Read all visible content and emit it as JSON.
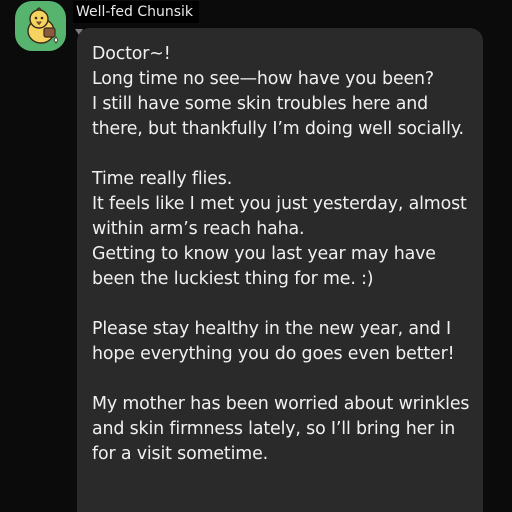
{
  "chat": {
    "sender_name": "Well-fed Chunsik",
    "avatar_icon": "chick-character-icon",
    "colors": {
      "background": "#0b0b0b",
      "bubble": "#2a2a2a",
      "avatar_bg": "#57b46f",
      "text": "#f0f0f0"
    },
    "message": {
      "lines": [
        "Doctor~!",
        "Long time no see—how have you been?",
        "I still have some skin troubles here and",
        "there, but thankfully I’m doing well socially.",
        "",
        "Time really flies.",
        "It feels like I met you just yesterday, almost",
        "within arm’s reach haha.",
        "Getting to know you last year may have",
        "been the luckiest thing for me. :)",
        "",
        "Please stay healthy in the new year, and I",
        "hope everything you do goes even better!",
        "",
        "My mother has been worried about wrinkles",
        "and skin firmness lately, so I’ll bring her in",
        "for a visit sometime."
      ]
    }
  }
}
